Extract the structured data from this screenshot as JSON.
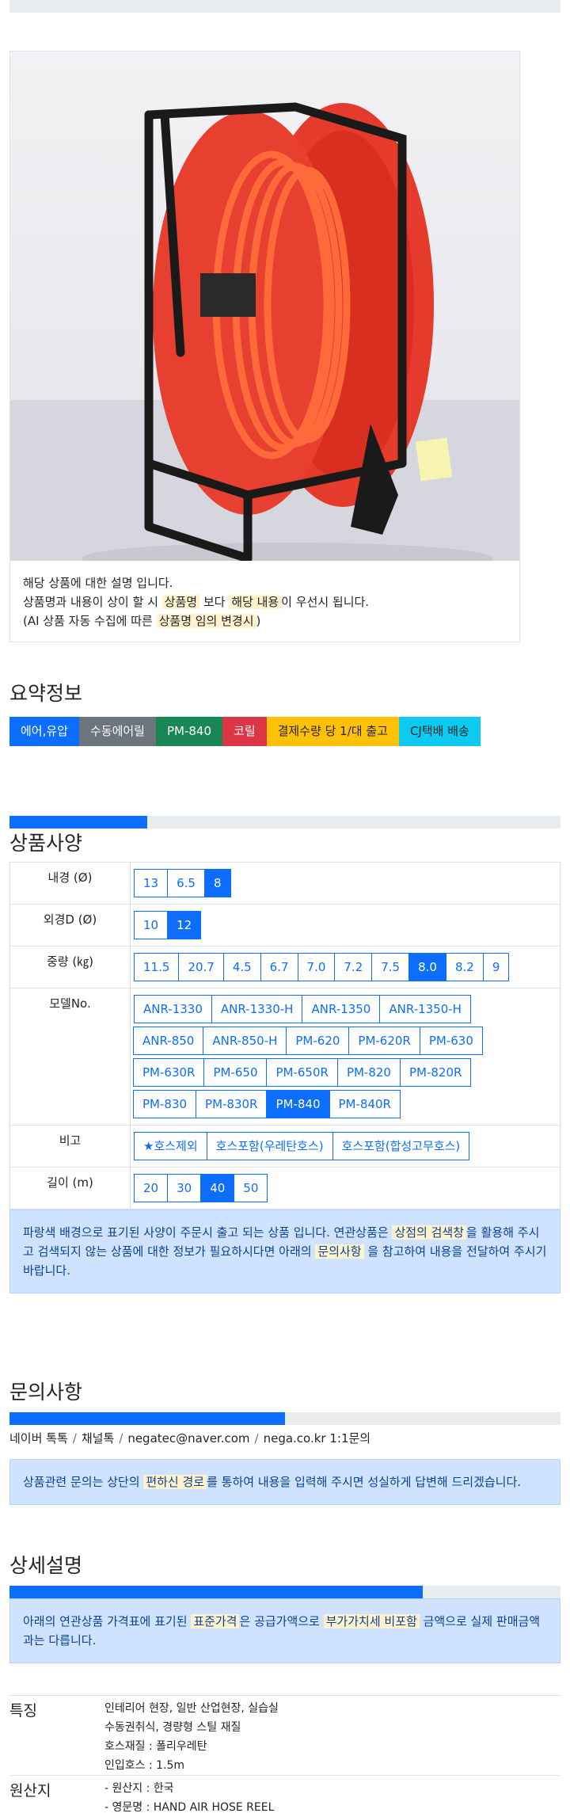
{
  "product": {
    "description": {
      "line1": "해당 상품에 대한 설명 입니다.",
      "line2_a": "상품명과 내용이 상이 할 시 ",
      "line2_hl1": "상품명",
      "line2_b": " 보다 ",
      "line2_hl2": "해당 내용",
      "line2_c": "이 우선시 됩니다.",
      "line3_a": "(AI 상품 자동 수집에 따른 ",
      "line3_hl": "상품명 임의 변경시",
      "line3_b": ")"
    }
  },
  "summary": {
    "title": "요약정보",
    "badges": [
      {
        "label": "에어,유압",
        "color": "#0d6efd"
      },
      {
        "label": "수동에어릴",
        "color": "#6c757d"
      },
      {
        "label": "PM-840",
        "color": "#198754"
      },
      {
        "label": "코릴",
        "color": "#dc3545"
      },
      {
        "label": "결제수량 당 1/대 출고",
        "color": "#ffc107"
      },
      {
        "label": "CJ택배 배송",
        "color": "#0dcaf0"
      }
    ]
  },
  "spec": {
    "title": "상품사양",
    "progress": 0.25,
    "rows": [
      {
        "label": "내경 (Ø)",
        "options": [
          "13",
          "6.5",
          "8"
        ],
        "selected": "8"
      },
      {
        "label": "외경D (Ø)",
        "options": [
          "10",
          "12"
        ],
        "selected": "12"
      },
      {
        "label": "중량 (㎏)",
        "options": [
          "11.5",
          "20.7",
          "4.5",
          "6.7",
          "7.0",
          "7.2",
          "7.5",
          "8.0",
          "8.2",
          "9"
        ],
        "selected": "8.0"
      },
      {
        "label": "모델No.",
        "options": [
          "ANR-1330",
          "ANR-1330-H",
          "ANR-1350",
          "ANR-1350-H",
          "ANR-850",
          "ANR-850-H",
          "PM-620",
          "PM-620R",
          "PM-630",
          "PM-630R",
          "PM-650",
          "PM-650R",
          "PM-820",
          "PM-820R",
          "PM-830",
          "PM-830R",
          "PM-840",
          "PM-840R"
        ],
        "selected": "PM-840"
      },
      {
        "label": "비고",
        "options": [
          "★호스제외",
          "호스포함(우레탄호스)",
          "호스포함(합성고무호스)"
        ],
        "selected": ""
      },
      {
        "label": "길이 (m)",
        "options": [
          "20",
          "30",
          "40",
          "50"
        ],
        "selected": "40"
      }
    ],
    "notice_a": "파랑색 배경으로 표기된 사양이 주문시 출고 되는 상품 입니다. 연관상품은 ",
    "notice_hl1": "상점의 검색창",
    "notice_b": "을 활용해 주시고 검색되지 않는 상품에 대한 정보가 필요하시다면 아래의 ",
    "notice_hl2": "문의사항",
    "notice_c": " 을 참고하여 내용을 전달하여 주시기 바랍니다."
  },
  "inquiry": {
    "title": "문의사항",
    "progress": 0.5,
    "contacts": [
      "네이버 톡톡",
      "채널톡",
      "negatec@naver.com",
      "nega.co.kr 1:1문의"
    ],
    "sep": "/",
    "notice_a": "상품관련 문의는 상단의 ",
    "notice_hl": "편하신 경로",
    "notice_b": "를 통하여 내용을 입력해 주시면 성실하게 답변해 드리겠습니다."
  },
  "detail": {
    "title": "상세설명",
    "progress": 0.75,
    "notice_a": "아래의 연관상품 가격표에 표기된 ",
    "notice_hl1": "표준가격",
    "notice_b": "은 공급가액으로 ",
    "notice_hl2": "부가가치세 비포함",
    "notice_c": " 금액으로 실제 판매금액과는 다릅니다."
  },
  "features": [
    {
      "label": "특징",
      "lines": [
        "인테리어 현장, 일반 산업현장, 실습실",
        "수동권취식, 경량형 스틸 재질",
        "호스재질 : 폴리우레탄",
        "인입호스 : 1.5m"
      ]
    },
    {
      "label": "원산지",
      "lines": [
        "- 원산지 : 한국",
        "- 영문명 : HAND AIR HOSE REEL"
      ]
    }
  ]
}
